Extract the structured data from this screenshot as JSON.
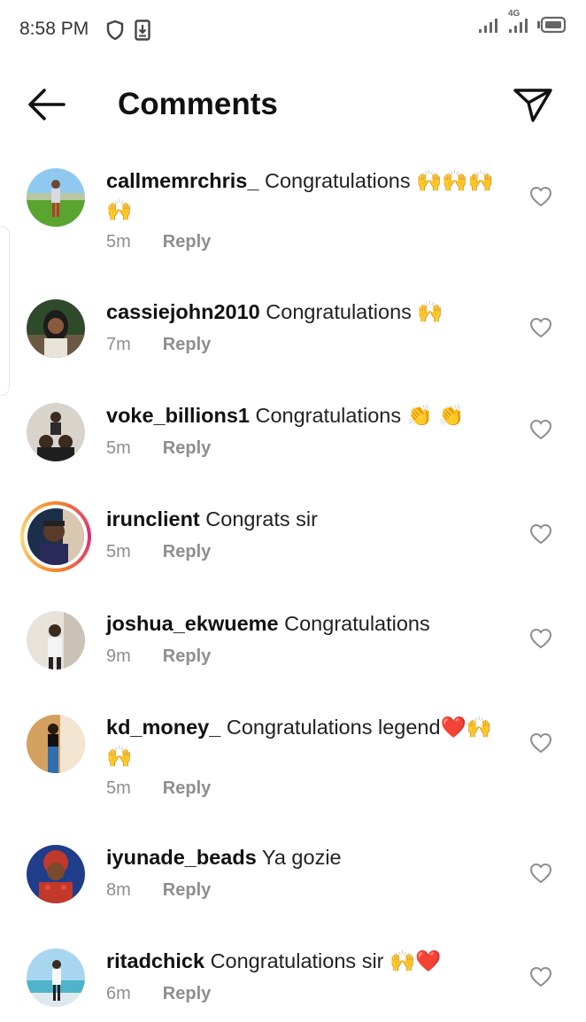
{
  "status_bar": {
    "time": "8:58 PM",
    "network": "4G"
  },
  "header": {
    "title": "Comments"
  },
  "comments": [
    {
      "username": "callmemrchris_",
      "text": "Congratulations 🙌🙌🙌🙌",
      "time": "5m",
      "reply_label": "Reply"
    },
    {
      "username": "cassiejohn2010",
      "text": "Congratulations 🙌",
      "time": "7m",
      "reply_label": "Reply"
    },
    {
      "username": "voke_billions1",
      "text": "Congratulations 👏 👏",
      "time": "5m",
      "reply_label": "Reply"
    },
    {
      "username": "irunclient",
      "text": "Congrats sir",
      "time": "5m",
      "reply_label": "Reply"
    },
    {
      "username": "joshua_ekwueme",
      "text": "Congratulations",
      "time": "9m",
      "reply_label": "Reply"
    },
    {
      "username": "kd_money_",
      "text": "Congratulations legend❤️🙌🙌",
      "time": "5m",
      "reply_label": "Reply"
    },
    {
      "username": "iyunade_beads",
      "text": "Ya gozie",
      "time": "8m",
      "reply_label": "Reply"
    },
    {
      "username": "ritadchick",
      "text": "Congratulations sir 🙌❤️",
      "time": "6m",
      "reply_label": "Reply"
    }
  ]
}
